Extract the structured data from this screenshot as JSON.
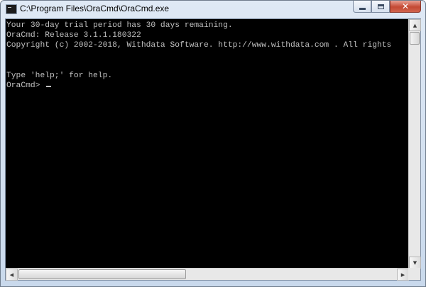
{
  "window": {
    "title": "C:\\Program Files\\OraCmd\\OraCmd.exe",
    "icon": "console-icon"
  },
  "caption_buttons": {
    "minimize": "minimize-icon",
    "maximize": "maximize-icon",
    "close": "close-icon",
    "close_glyph": "✕"
  },
  "console": {
    "background_color": "#000000",
    "text_color": "#c0c0c0",
    "lines": [
      "Your 30-day trial period has 30 days remaining.",
      "OraCmd: Release 3.1.1.180322",
      "Copyright (c) 2002-2018, Withdata Software. http://www.withdata.com . All rights",
      "",
      "",
      "Type 'help;' for help.",
      "OraCmd> "
    ]
  },
  "scrollbars": {
    "up_arrow": "▲",
    "down_arrow": "▼",
    "left_arrow": "◀",
    "right_arrow": "▶"
  }
}
